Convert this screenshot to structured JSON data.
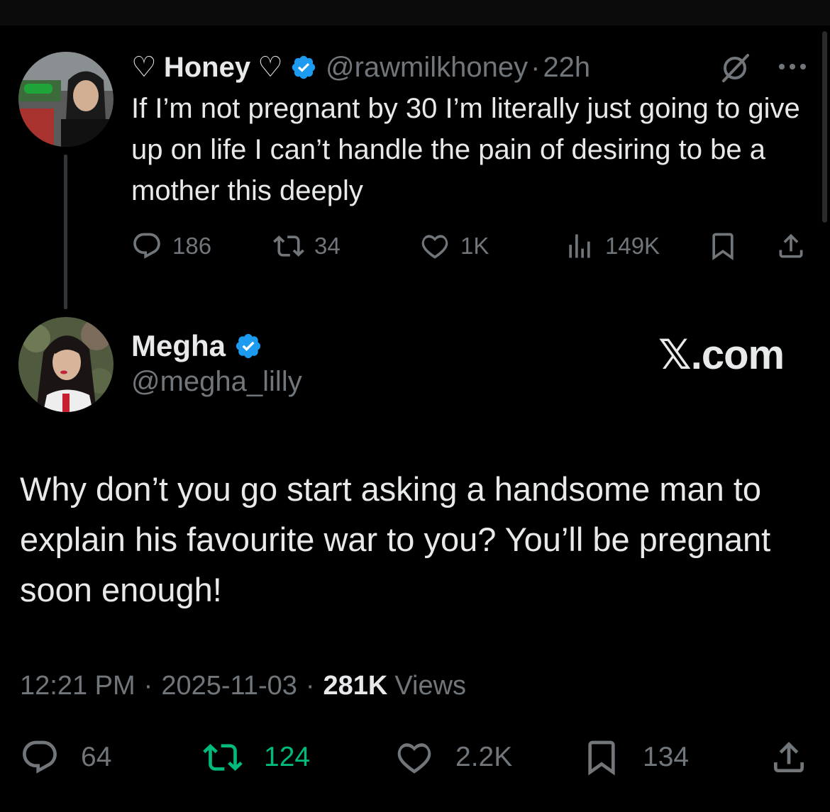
{
  "parent_tweet": {
    "name": "Honey",
    "name_prefix_glyph": "♡",
    "name_suffix_glyph": "♡",
    "verified": true,
    "handle": "@rawmilkhoney",
    "separator": "·",
    "time": "22h",
    "text": "If I’m not pregnant by 30 I’m literally just going to give up on life I can’t handle the pain of desiring to be a mother this deeply",
    "stats": {
      "replies": "186",
      "reposts": "34",
      "likes": "1K",
      "views": "149K"
    }
  },
  "main_tweet": {
    "name": "Megha",
    "verified": true,
    "handle": "@megha_lilly",
    "watermark": "𝕏.com",
    "text": "Why don’t you go start asking a handsome man to explain his favourite war to you? You’ll be pregnant soon enough!",
    "time": "12:21 PM",
    "date": "2025-11-03",
    "separator": "·",
    "views_count": "281K",
    "views_label": "Views",
    "stats": {
      "replies": "64",
      "reposts": "124",
      "likes": "2.2K",
      "bookmarks": "134"
    }
  },
  "colors": {
    "background": "#000000",
    "text_primary": "#e7e9ea",
    "text_secondary": "#71767b",
    "verified_blue": "#1d9bf0",
    "repost_green": "#00ba7c",
    "thread_line": "#333639"
  },
  "icons": [
    "verified-badge-icon",
    "grok-icon",
    "more-icon",
    "reply-icon",
    "repost-icon",
    "like-icon",
    "views-icon",
    "bookmark-icon",
    "share-icon"
  ]
}
